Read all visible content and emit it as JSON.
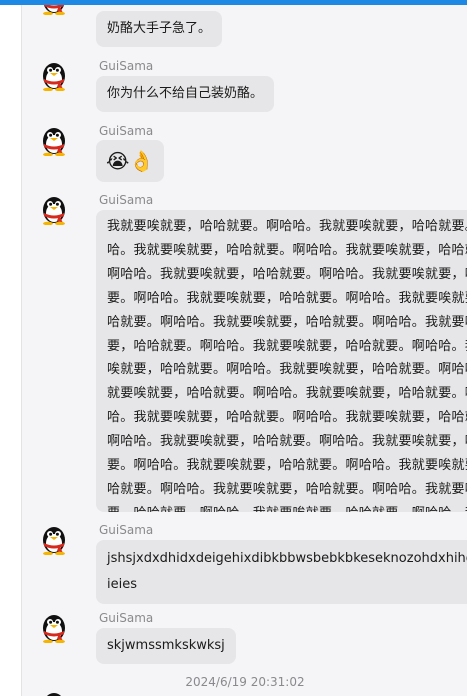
{
  "conversation": {
    "messages": [
      {
        "sender": "",
        "text": "奶酪大手子急了。"
      },
      {
        "sender": "GuiSama",
        "text": "你为什么不给自己装奶酪。"
      },
      {
        "sender": "GuiSama",
        "text": "😭👌"
      },
      {
        "sender": "GuiSama",
        "text": "我就要唉就要，哈哈就要。啊哈哈。我就要唉就要，哈哈就要。啊哈哈。我就要唉就要，哈哈就要。啊哈哈。我就要唉就要，哈哈就要。啊哈哈。我就要唉就要，哈哈就要。啊哈哈。我就要唉就要，哈哈就要。啊哈哈。我就要唉就要，哈哈就要。啊哈哈。我就要唉就要，哈哈就要。啊哈哈。我就要唉就要，哈哈就要。啊哈哈。我就要唉就要，哈哈就要。啊哈哈。我就要唉就要，哈哈就要。啊哈哈。我就要唉就要，哈哈就要。啊哈哈。我就要唉就要，哈哈就要。啊哈哈。我就要唉就要，哈哈就要。啊哈哈。我就要唉就要，哈哈就要。啊哈哈。我就要唉就要，哈哈就要。啊哈哈。我就要唉就要，哈哈就要。啊哈哈。我就要唉就要，哈哈就要。啊哈哈。我就要唉就要，哈哈就要。啊哈哈。我就要唉就要，哈哈就要。啊哈哈。我就要唉就要，哈哈就要。啊哈哈。我就要唉就要，哈哈就要。啊哈哈。我就要唉就要，哈哈就要。啊哈哈。我就要唉就要，哈哈就要。啊哈哈。我就要唉就要，哈哈就要。啊哈哈。我就要唉就要，哈哈就要。啊哈哈。"
      },
      {
        "sender": "GuiSama",
        "text": "jshsjxdxdhidxdeigehixdibkbbwsbebkbkeseknozohdxhihdhrhhieies"
      },
      {
        "sender": "GuiSama",
        "text": "skjwmssmkskwksj"
      }
    ],
    "timestamp": "2024/6/19 20:31:02"
  },
  "colors": {
    "accent_bar": "#1e88e5",
    "bubble": "#e6e6e8",
    "background": "#f5f5f7"
  },
  "icons": {
    "avatar": "penguin-avatar-icon"
  }
}
